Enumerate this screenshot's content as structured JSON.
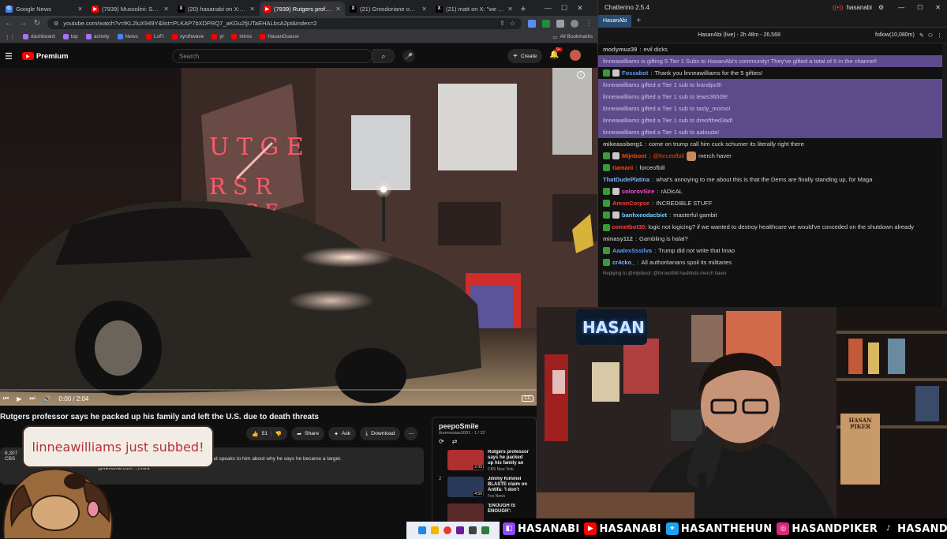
{
  "browser": {
    "tabs": [
      {
        "title": "Google News",
        "color": "#4285f4",
        "glyph": "G"
      },
      {
        "title": "(7939) Mussolini: Son Of",
        "color": "#ff0000",
        "glyph": "▶"
      },
      {
        "title": "(20) hasanabi on X: \"PALESTIN",
        "color": "#000000",
        "glyph": "X"
      },
      {
        "title": "(7939) Rutgers professor s",
        "color": "#ff0000",
        "glyph": "▶",
        "active": true
      },
      {
        "title": "(21) Grosdoriane on X: \"It is ju",
        "color": "#000000",
        "glyph": "X"
      },
      {
        "title": "(21) matt on X: \"we told zohr",
        "color": "#000000",
        "glyph": "X"
      }
    ],
    "new_tab": "+",
    "url": "youtube.com/watch?v=lKL2luX949Y&list=PLKAP7bXDPRQ7_aKGu2fjUTaEHALbsA2pt&index=2",
    "bookmarks": [
      {
        "label": "dashboard",
        "color": "#a970ff"
      },
      {
        "label": "top",
        "color": "#a970ff"
      },
      {
        "label": "activity",
        "color": "#a970ff"
      },
      {
        "label": "News",
        "color": "#4285f4"
      },
      {
        "label": "LoFi",
        "color": "#ff0000"
      },
      {
        "label": "synthwave",
        "color": "#ff0000"
      },
      {
        "label": "yt",
        "color": "#ff0000"
      },
      {
        "label": "intros",
        "color": "#ff0000"
      },
      {
        "label": "HasanGuessr",
        "color": "#ff0000"
      }
    ],
    "all_bookmarks": "All Bookmarks"
  },
  "youtube": {
    "logo": "Premium",
    "search_placeholder": "Search",
    "create_label": "Create",
    "notif_count": "9+",
    "time": "0:00 / 2:04",
    "cc": "CC",
    "video_title": "Rutgers professor says he packed up his family and left the U.S. due to death threats",
    "likes": "51",
    "share": "Share",
    "ask": "Ask",
    "download": "Download",
    "views_partial": "6,307",
    "desc_partial": "CBS",
    "desc_text": "nd speaks to him about why he says he became a target.",
    "desc_email": "@veritone.com ...more",
    "playlist_title": "peepoSmile",
    "playlist_meta": "themessias1001 - 1 / 22",
    "playlist_items": [
      {
        "num": "",
        "title": "Rutgers professor says he packed up his family an",
        "channel": "CBS New York",
        "dur": "2:05"
      },
      {
        "num": "2",
        "title": "Jimmy Kimmel BLASTE claim on Antifa: 'I don't",
        "channel": "Fox News",
        "dur": "4:59"
      },
      {
        "num": "",
        "title": "'ENOUGH IS ENOUGH':",
        "channel": "",
        "dur": ""
      }
    ],
    "video_sign": "RUTGERS"
  },
  "chatterino": {
    "title": "Chatterino 2.5.4",
    "user": "hasanabi",
    "tab": "HasanAbi",
    "channel_info": "HasanAbi (live) - 2h 48m - 26,568",
    "follow": "follow(10,080m)",
    "messages": [
      {
        "user": "modymuz39",
        "text": "evil dicks",
        "color": "#b0b0b0",
        "type": "normal"
      },
      {
        "user": "",
        "text": "linneawilliams is gifting 5 Tier 1 Subs to HasanAbi's community! They've gifted a total of 5 in the channel!",
        "color": "#cfc1e8",
        "type": "sub"
      },
      {
        "user": "Fossabot",
        "text": "Thank you linneawilliams for the 5 gifties!",
        "color": "#5b99ff",
        "type": "normal"
      },
      {
        "user": "",
        "text": "linneawilliams gifted a Tier 1 sub to lvandpc8!",
        "type": "sub"
      },
      {
        "user": "",
        "text": "linneawilliams gifted a Tier 1 sub to lewis36509!",
        "type": "sub"
      },
      {
        "user": "",
        "text": "linneawilliams gifted a Tier 1 sub to tasty_momo!",
        "type": "sub"
      },
      {
        "user": "",
        "text": "linneawilliams gifted a Tier 1 sub to dreofthed3ad!",
        "type": "sub"
      },
      {
        "user": "",
        "text": "linneawilliams gifted a Tier 1 sub to aalouda!",
        "type": "sub"
      },
      {
        "user": "mikeassberg1",
        "text": "come on trump call him cuck schumer its literally right there",
        "color": "#b0b0b0",
        "type": "normal"
      },
      {
        "user": "Mijnboot",
        "text": "@forceofbill",
        "text2": "merch haver",
        "color": "#ff4500",
        "type": "normal"
      },
      {
        "user": "tiamani",
        "text": "forceofbill",
        "color": "#ff4500",
        "type": "normal"
      },
      {
        "user": "ThatDudePlatina",
        "text": "what's annoying to me about this is that the Dems are finally standing up, for Maga",
        "color": "#7fb2ff",
        "type": "normal"
      },
      {
        "user": "colorovSire",
        "text": "rADicAL",
        "color": "#ff4fd8",
        "type": "normal"
      },
      {
        "user": "AmonCorpse",
        "text": "INCREDIBLE STUFF",
        "color": "#ff3b3b",
        "type": "normal"
      },
      {
        "user": "banhxeodacbiet",
        "text": "masterful gambit",
        "color": "#7ad0ff",
        "type": "normal"
      },
      {
        "user": "cometbot30",
        "text": "logic not logicing? if we wanted to destroy healthcare we would've conceded on the shutdown already",
        "color": "#ff4040",
        "type": "wrap"
      },
      {
        "user": "minasy112",
        "text": "Gambling is halal?",
        "color": "#b0b0b0",
        "type": "normal"
      },
      {
        "user": "AaalexSssilva",
        "text": "Trump did not write that lmao",
        "color": "#5b99ff",
        "type": "normal"
      },
      {
        "user": "cr4cko_",
        "text": "All authoritarians spoil its militaries",
        "color": "#7fb2ff",
        "type": "normal"
      },
      {
        "user": "",
        "text": "Replying to @mijnboot: @forceofbill hasMods merch haver",
        "color": "#888",
        "type": "reply"
      }
    ]
  },
  "stream": {
    "sub_alert": "linneawilliams just subbed!",
    "neon_sign": "HASAN",
    "poster": "HASAN PIKER",
    "socials": [
      {
        "name": "HASANABI",
        "platform": "twitch-icon",
        "color": "#9146ff"
      },
      {
        "name": "HASANABI",
        "platform": "youtube-icon",
        "color": "#ff0000"
      },
      {
        "name": "HASANTHEHUN",
        "platform": "twitter-icon",
        "color": "#1da1f2"
      },
      {
        "name": "HASANDPIKER",
        "platform": "instagram-icon",
        "color": "#d62976"
      },
      {
        "name": "HASANDPIKER",
        "platform": "tiktok-icon",
        "color": "#000000"
      }
    ]
  }
}
